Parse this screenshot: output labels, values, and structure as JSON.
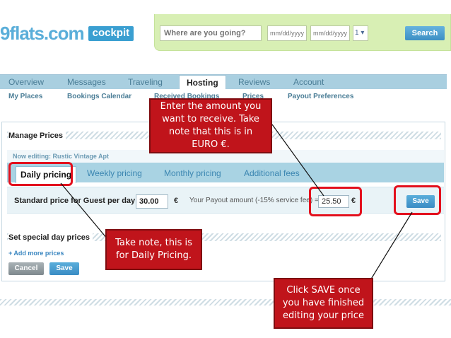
{
  "header": {
    "logo_text": "9flats.com",
    "logo_badge": "cockpit",
    "search_placeholder": "Where are you going?",
    "checkin_placeholder": "mm/dd/yyyy",
    "checkout_placeholder": "mm/dd/yyyy",
    "guests_value": "1 ▾",
    "search_button": "Search"
  },
  "nav": {
    "tabs": [
      {
        "label": "Overview"
      },
      {
        "label": "Messages"
      },
      {
        "label": "Traveling"
      },
      {
        "label": "Hosting"
      },
      {
        "label": "Reviews"
      },
      {
        "label": "Account"
      }
    ],
    "subtabs": [
      {
        "label": "My Places"
      },
      {
        "label": "Bookings Calendar"
      },
      {
        "label": "Received Bookings"
      },
      {
        "label": "Prices"
      },
      {
        "label": "Payout Preferences"
      }
    ]
  },
  "manage": {
    "title": "Manage Prices",
    "listing_label": "Now editing: Rustic Vintage Apt",
    "tabs": [
      {
        "label": "Daily pricing"
      },
      {
        "label": "Weekly pricing"
      },
      {
        "label": "Monthly pricing"
      },
      {
        "label": "Additional fees"
      }
    ],
    "price_label": "Standard price for Guest per day",
    "price_value": "30.00",
    "currency": "€",
    "payout_label": "Your Payout amount (-15% service fee) =",
    "payout_value": "25.50",
    "save_label": "Save"
  },
  "special": {
    "title": "Set special day prices",
    "add_more": "+ Add more prices",
    "cancel_label": "Cancel",
    "save_label": "Save"
  },
  "callouts": {
    "amount": "Enter the amount you want to receive. Take note that this is in EURO €.",
    "daily": "Take note, this is for Daily Pricing.",
    "save": "Click SAVE once you have finished editing your price"
  },
  "colors": {
    "callout": "#c0141b",
    "highlight": "#e3101d",
    "accent": "#3a9fd1",
    "search_bg": "#d8efb4"
  }
}
